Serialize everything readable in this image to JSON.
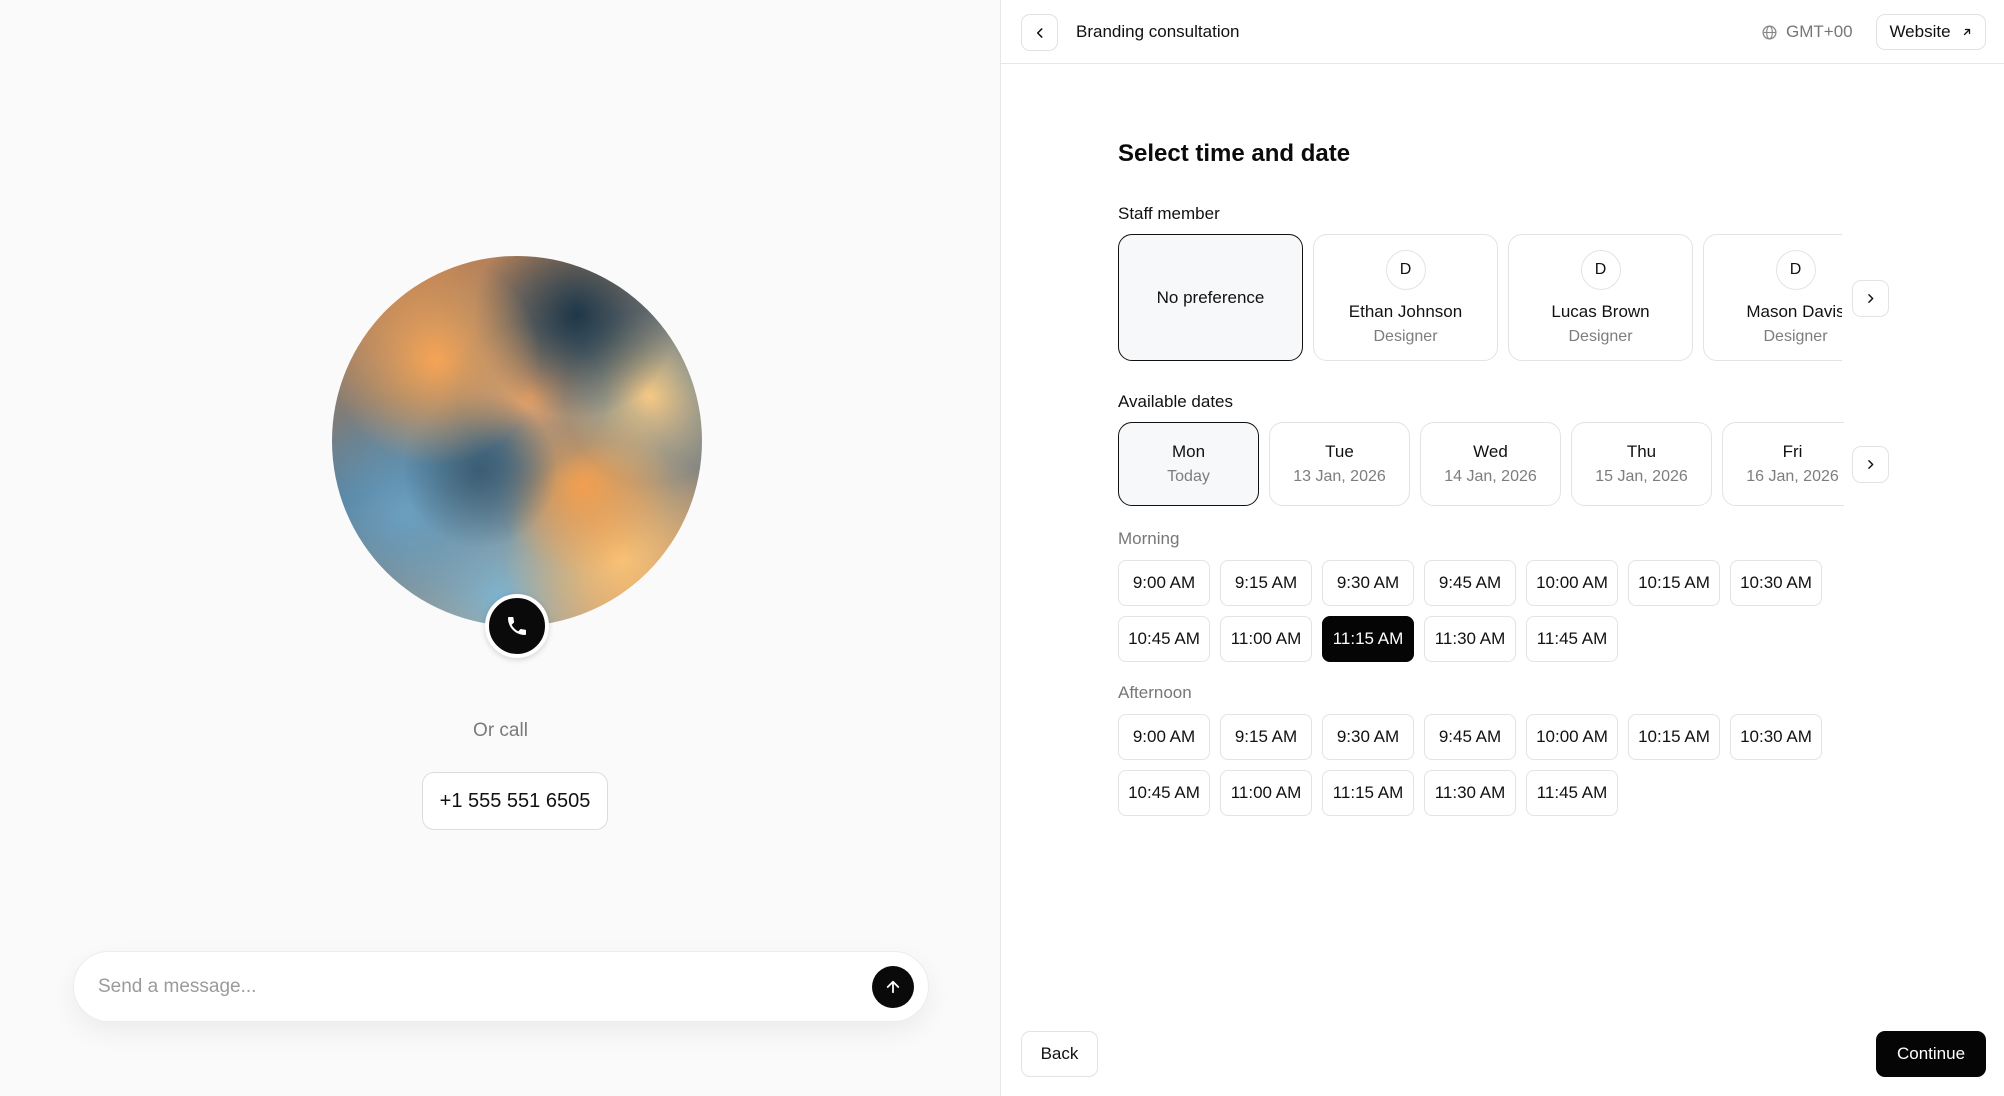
{
  "left": {
    "or_call": "Or call",
    "phone": "+1 555 551 6505",
    "message_placeholder": "Send a message...",
    "icons": {
      "call": "phone-icon",
      "send": "arrow-up-icon"
    }
  },
  "topbar": {
    "title": "Branding consultation",
    "timezone": "GMT+00",
    "website_label": "Website",
    "icons": {
      "back": "chevron-left-icon",
      "globe": "globe-icon",
      "external": "arrow-up-right-icon"
    }
  },
  "main": {
    "heading": "Select time and date",
    "staff_label": "Staff member",
    "staff": [
      {
        "name": "No preference",
        "role": "",
        "initial": ""
      },
      {
        "name": "Ethan Johnson",
        "role": "Designer",
        "initial": "D"
      },
      {
        "name": "Lucas Brown",
        "role": "Designer",
        "initial": "D"
      },
      {
        "name": "Mason Davis",
        "role": "Designer",
        "initial": "D"
      }
    ],
    "dates_label": "Available dates",
    "dates": [
      {
        "day": "Mon",
        "date": "Today"
      },
      {
        "day": "Tue",
        "date": "13 Jan, 2026"
      },
      {
        "day": "Wed",
        "date": "14 Jan, 2026"
      },
      {
        "day": "Thu",
        "date": "15 Jan, 2026"
      },
      {
        "day": "Fri",
        "date": "16 Jan, 2026"
      }
    ],
    "morning_label": "Morning",
    "morning_slots": [
      "9:00 AM",
      "9:15 AM",
      "9:30 AM",
      "9:45 AM",
      "10:00 AM",
      "10:15 AM",
      "10:30 AM",
      "10:45 AM",
      "11:00 AM",
      "11:15 AM",
      "11:30 AM",
      "11:45 AM"
    ],
    "afternoon_label": "Afternoon",
    "afternoon_slots": [
      "9:00 AM",
      "9:15 AM",
      "9:30 AM",
      "9:45 AM",
      "10:00 AM",
      "10:15 AM",
      "10:30 AM",
      "10:45 AM",
      "11:00 AM",
      "11:15 AM",
      "11:30 AM",
      "11:45 AM"
    ],
    "selected_slot": "11:15 AM"
  },
  "footer": {
    "back_label": "Back",
    "continue_label": "Continue"
  },
  "colors": {
    "accent": "#050505",
    "muted_text": "#7d7d7d",
    "border": "#e3e3e3"
  }
}
